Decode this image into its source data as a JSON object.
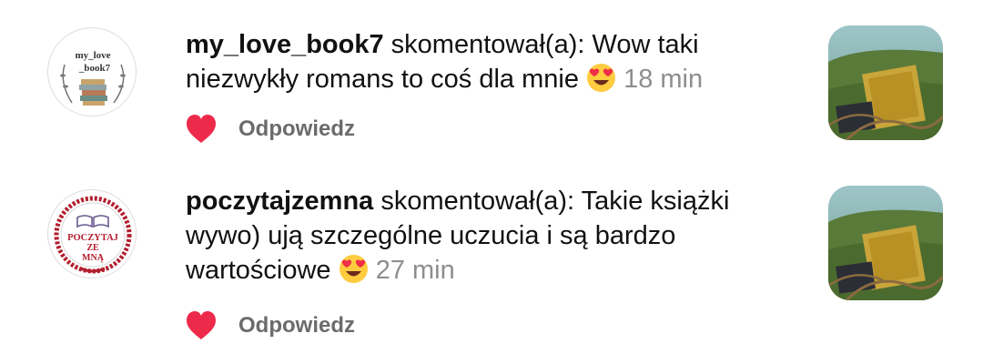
{
  "notifications": [
    {
      "username": "my_love_book7",
      "action": " skomentował(a): ",
      "comment": "Wow taki niezwykły romans to coś dla mnie",
      "emoji": "heart-eyes",
      "time": "18 min",
      "reply_label": "Odpowiedz",
      "liked": true,
      "avatar_text_1": "my_love",
      "avatar_text_2": "_book7"
    },
    {
      "username": "poczytajzemna",
      "action": " skomentował(a): ",
      "comment": "Takie książki wywo) ują szczególne uczucia i są bardzo wartościowe",
      "emoji": "heart-eyes",
      "time": "27 min",
      "reply_label": "Odpowiedz",
      "liked": true,
      "avatar_text_1": "POCZYTAJ",
      "avatar_text_2": "ZE",
      "avatar_text_3": "MNĄ"
    }
  ],
  "colors": {
    "heart": "#ed2a4a",
    "time": "#8e8e8e",
    "reply": "#6b6b6b"
  }
}
